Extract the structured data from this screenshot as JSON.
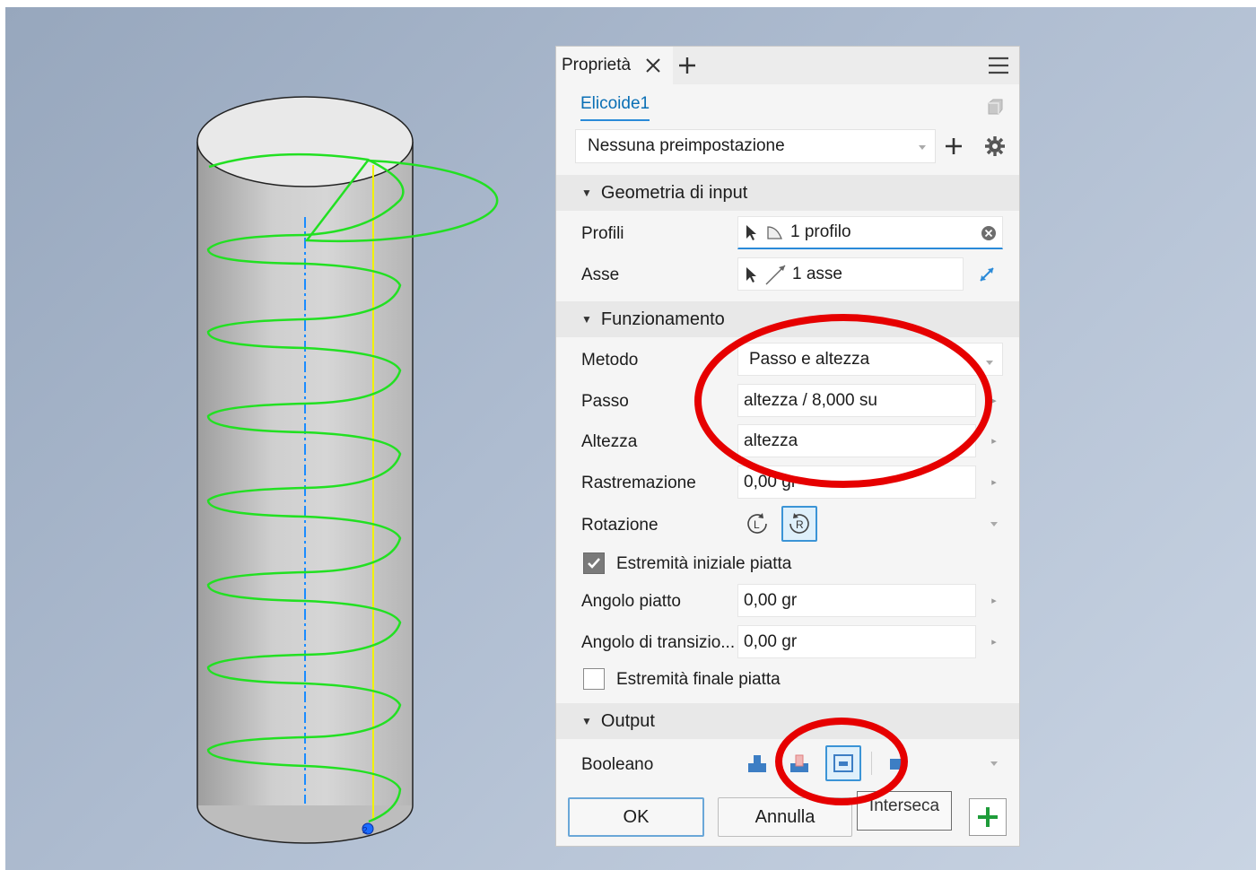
{
  "tab": {
    "label": "Proprietà"
  },
  "feature": {
    "name": "Elicoide1"
  },
  "preset": {
    "value": "Nessuna preimpostazione"
  },
  "sections": {
    "input": "Geometria di input",
    "behavior": "Funzionamento",
    "output": "Output"
  },
  "input": {
    "profiles_label": "Profili",
    "profiles_value": "1 profilo",
    "axis_label": "Asse",
    "axis_value": "1 asse"
  },
  "behavior": {
    "method_label": "Metodo",
    "method_value": "Passo e altezza",
    "pitch_label": "Passo",
    "pitch_value": "altezza / 8,000 su",
    "height_label": "Altezza",
    "height_value": "altezza",
    "taper_label": "Rastremazione",
    "taper_value": "0,00 gr",
    "rotation_label": "Rotazione",
    "flat_start_label": "Estremità iniziale piatta",
    "flat_start_checked": true,
    "flat_angle_label": "Angolo piatto",
    "flat_angle_value": "0,00 gr",
    "transition_angle_label": "Angolo di transizio...",
    "transition_angle_value": "0,00 gr",
    "flat_end_label": "Estremità finale piatta",
    "flat_end_checked": false
  },
  "output": {
    "boolean_label": "Booleano",
    "tooltip": "Interseca"
  },
  "buttons": {
    "ok": "OK",
    "cancel": "Annulla"
  },
  "colors": {
    "helix": "#22e022",
    "axis": "#1a8cff",
    "seam": "#f2f200",
    "annotation": "#e60000",
    "accent": "#2a8ad8"
  },
  "icons": {
    "close": "close-icon",
    "add": "plus-icon",
    "menu": "hamburger-menu-icon",
    "gear": "gear-icon",
    "rotation_left": "clockwise-rotation-icon",
    "rotation_right": "counterclockwise-rotation-icon"
  }
}
